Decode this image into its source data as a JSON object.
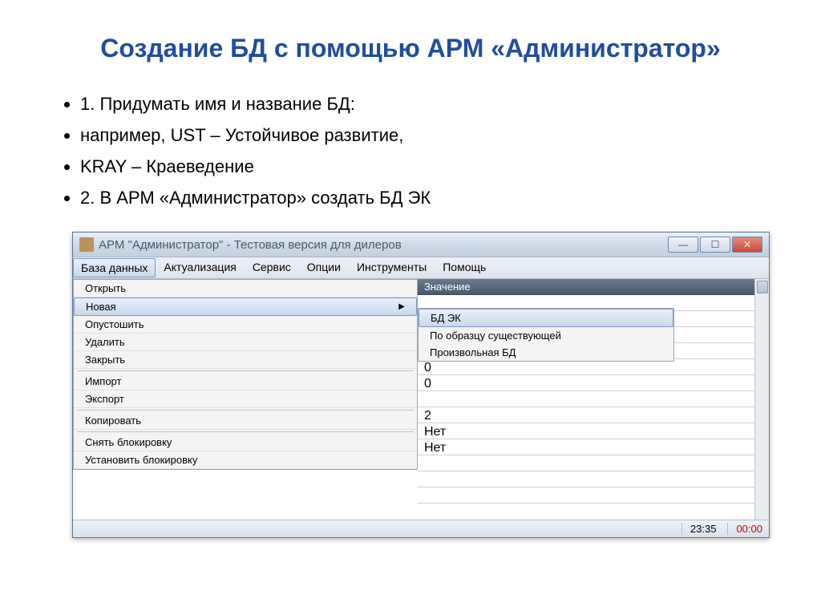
{
  "slide": {
    "title": "Создание БД с помощью АРМ «Администратор»",
    "bullets": [
      "1. Придумать имя и название БД:",
      "например, UST – Устойчивое развитие,",
      "KRAY – Краеведение",
      "2. В АРМ «Администратор» создать БД ЭК"
    ]
  },
  "window": {
    "title": "АРМ \"Администратор\" - Тестовая версия для дилеров",
    "min_icon": "—",
    "max_icon": "☐",
    "close_icon": "✕",
    "menubar": [
      "База данных",
      "Актуализация",
      "Сервис",
      "Опции",
      "Инструменты",
      "Помощь"
    ],
    "menu_db": {
      "open": "Открыть",
      "new": "Новая",
      "empty": "Опустошить",
      "delete": "Удалить",
      "close": "Закрыть",
      "import": "Импорт",
      "export": "Экспорт",
      "copy": "Копировать",
      "unlock": "Снять блокировку",
      "lock": "Установить блокировку"
    },
    "submenu_new": {
      "ek": "БД ЭК",
      "by_sample": "По образцу существующей",
      "arbitrary": "Произвольная БД"
    },
    "grid": {
      "header": "Значение",
      "rows": [
        "0",
        "0",
        "",
        "2",
        "Нет",
        "Нет"
      ]
    },
    "status": {
      "time1": "23:35",
      "time2": "00:00"
    }
  }
}
